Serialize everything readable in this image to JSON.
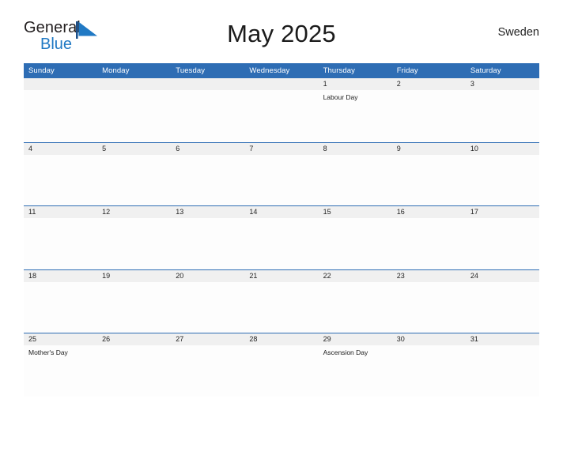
{
  "brand": {
    "name_part1": "General",
    "name_part2": "Blue",
    "logo_mark": "triangle-flag-icon",
    "accent_color": "#2079c4"
  },
  "header": {
    "title": "May 2025",
    "region": "Sweden"
  },
  "calendar": {
    "header_color": "#2e6db4",
    "band_color": "#f0f0f0",
    "weekdays": [
      "Sunday",
      "Monday",
      "Tuesday",
      "Wednesday",
      "Thursday",
      "Friday",
      "Saturday"
    ],
    "weeks": [
      [
        {
          "day": "",
          "event": ""
        },
        {
          "day": "",
          "event": ""
        },
        {
          "day": "",
          "event": ""
        },
        {
          "day": "",
          "event": ""
        },
        {
          "day": "1",
          "event": "Labour Day"
        },
        {
          "day": "2",
          "event": ""
        },
        {
          "day": "3",
          "event": ""
        }
      ],
      [
        {
          "day": "4",
          "event": ""
        },
        {
          "day": "5",
          "event": ""
        },
        {
          "day": "6",
          "event": ""
        },
        {
          "day": "7",
          "event": ""
        },
        {
          "day": "8",
          "event": ""
        },
        {
          "day": "9",
          "event": ""
        },
        {
          "day": "10",
          "event": ""
        }
      ],
      [
        {
          "day": "11",
          "event": ""
        },
        {
          "day": "12",
          "event": ""
        },
        {
          "day": "13",
          "event": ""
        },
        {
          "day": "14",
          "event": ""
        },
        {
          "day": "15",
          "event": ""
        },
        {
          "day": "16",
          "event": ""
        },
        {
          "day": "17",
          "event": ""
        }
      ],
      [
        {
          "day": "18",
          "event": ""
        },
        {
          "day": "19",
          "event": ""
        },
        {
          "day": "20",
          "event": ""
        },
        {
          "day": "21",
          "event": ""
        },
        {
          "day": "22",
          "event": ""
        },
        {
          "day": "23",
          "event": ""
        },
        {
          "day": "24",
          "event": ""
        }
      ],
      [
        {
          "day": "25",
          "event": "Mother's Day"
        },
        {
          "day": "26",
          "event": ""
        },
        {
          "day": "27",
          "event": ""
        },
        {
          "day": "28",
          "event": ""
        },
        {
          "day": "29",
          "event": "Ascension Day"
        },
        {
          "day": "30",
          "event": ""
        },
        {
          "day": "31",
          "event": ""
        }
      ]
    ]
  }
}
